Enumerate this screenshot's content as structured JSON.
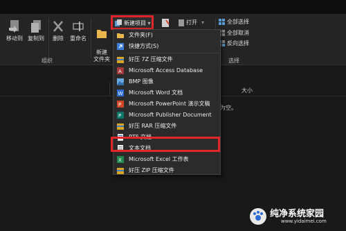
{
  "ribbon": {
    "move_to": "移动到",
    "copy_to": "复制到",
    "delete": "删除",
    "rename": "重命名",
    "new_folder": "新建\n文件夹",
    "new_item": "新建项目",
    "open": "打开",
    "select_all": "全部选择",
    "select_none": "全部取消",
    "invert_selection": "反向选择",
    "group_organize": "组织",
    "group_select": "选择"
  },
  "menu": {
    "items": [
      {
        "label": "文件夹(F)",
        "icon": "folder-icon"
      },
      {
        "label": "快捷方式(S)",
        "icon": "shortcut-icon"
      },
      {
        "label": "好压 7Z 压缩文件",
        "icon": "archive-icon"
      },
      {
        "label": "Microsoft Access Database",
        "icon": "access-icon"
      },
      {
        "label": "BMP 图像",
        "icon": "bmp-icon"
      },
      {
        "label": "Microsoft Word 文档",
        "icon": "word-icon"
      },
      {
        "label": "Microsoft PowerPoint 演示文稿",
        "icon": "powerpoint-icon"
      },
      {
        "label": "Microsoft Publisher Document",
        "icon": "publisher-icon"
      },
      {
        "label": "好压 RAR 压缩文件",
        "icon": "archive-icon"
      },
      {
        "label": "RTF 文档",
        "icon": "rtf-icon"
      },
      {
        "label": "文本文档",
        "icon": "text-document-icon"
      },
      {
        "label": "Microsoft Excel 工作表",
        "icon": "excel-icon"
      },
      {
        "label": "好压 ZIP 压缩文件",
        "icon": "archive-icon"
      }
    ]
  },
  "content": {
    "col_size": "大小",
    "empty_fragment": "为空。"
  },
  "watermark": {
    "site_name": "纯净系统家园",
    "site_url": "www.yidaimei.com"
  },
  "colors": {
    "highlight": "#e0262a",
    "folder": "#e8b64a",
    "word": "#2b6cd4",
    "excel": "#1f8a4c",
    "powerpoint": "#d24726",
    "access": "#a4373a",
    "publisher": "#077568"
  }
}
